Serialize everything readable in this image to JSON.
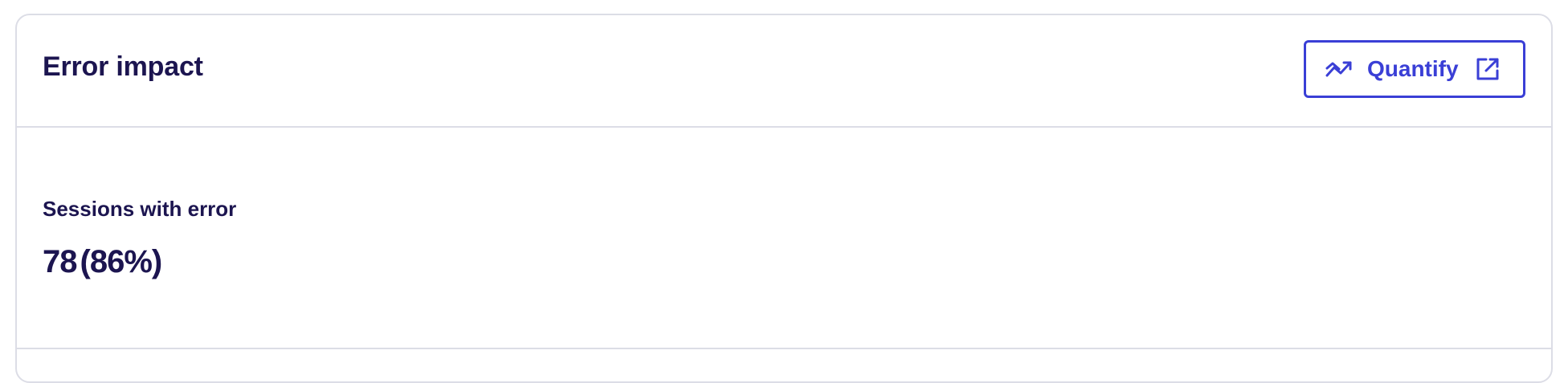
{
  "card": {
    "title": "Error impact",
    "quantify_button": {
      "label": "Quantify",
      "leading_icon": "trend-chart-icon",
      "trailing_icon": "external-link-icon"
    }
  },
  "metric": {
    "label": "Sessions with error",
    "count": "78",
    "percent": "(86%)"
  },
  "colors": {
    "text": "#1c1550",
    "accent": "#3a3fd6",
    "border": "#dcdde6"
  }
}
